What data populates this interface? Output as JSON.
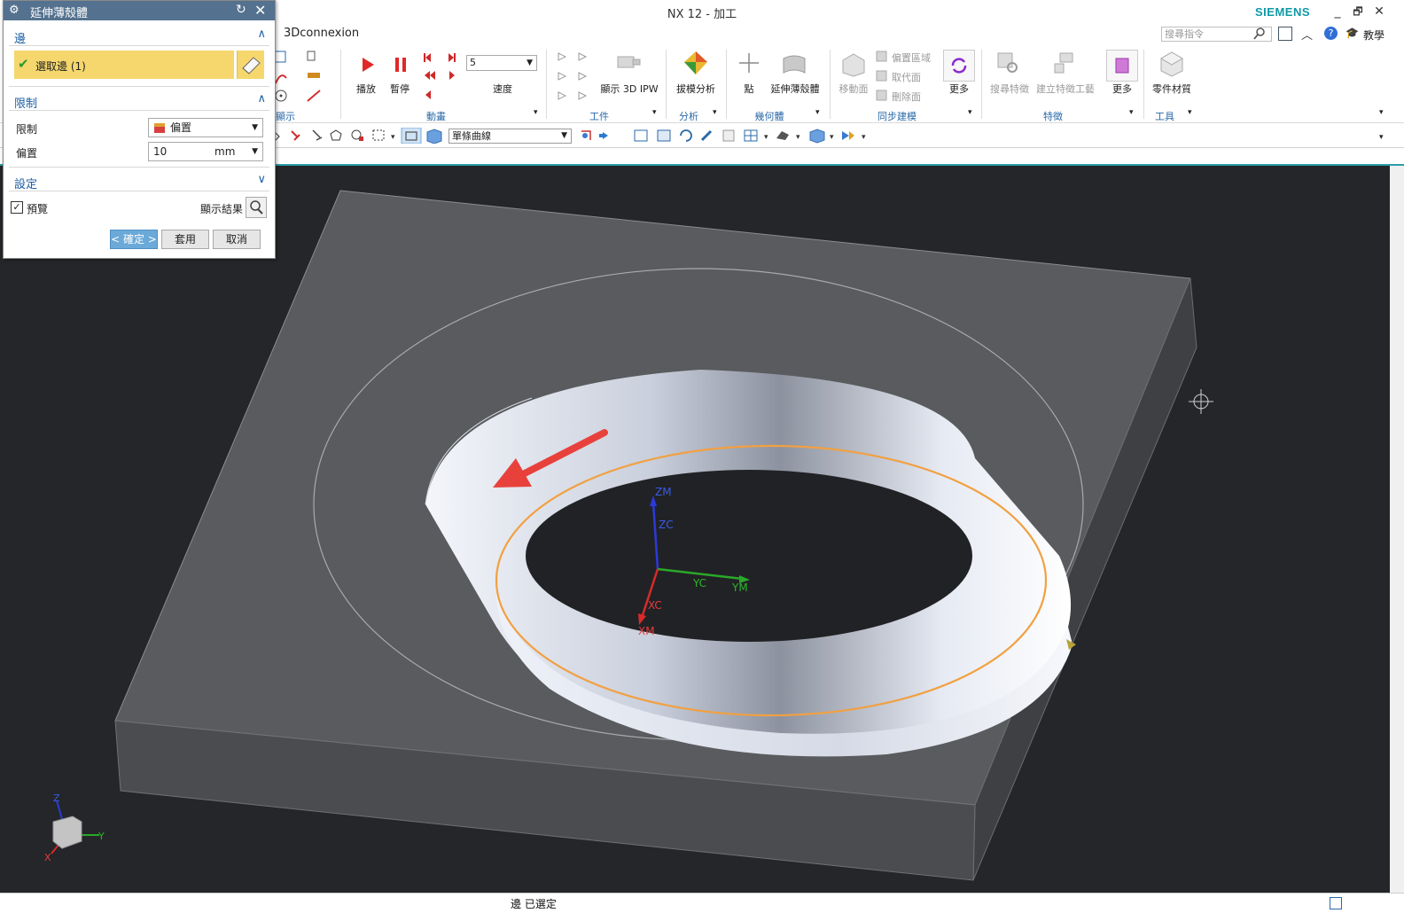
{
  "window": {
    "title": "NX 12 - 加工",
    "brand": "SIEMENS",
    "minimize": "_",
    "restore": "🗗",
    "close": "✕",
    "help_label": "教學"
  },
  "ribbon": {
    "visible_tab": "3Dconnexion",
    "search_placeholder": "搜尋指令",
    "partial_group_label": "顯示",
    "animation": {
      "play": "播放",
      "pause": "暫停",
      "speed_value": "5",
      "speed_label": "速度",
      "group": "動畫"
    },
    "work": {
      "ipw": "顯示 3D IPW",
      "group": "工件"
    },
    "analysis": {
      "draft": "拔模分析",
      "group": "分析"
    },
    "geometry": {
      "point": "點",
      "extend_shell": "延伸薄殼體",
      "group": "幾何體"
    },
    "sync": {
      "move_face": "移動面",
      "offset_region": "偏置區域",
      "replace_face": "取代面",
      "delete_face": "刪除面",
      "more": "更多",
      "group": "同步建模"
    },
    "feature": {
      "search_feature": "搜尋特徵",
      "create_tool": "建立特徵工藝",
      "more": "更多",
      "group": "特徵"
    },
    "tools": {
      "material": "零件材質",
      "group": "工具"
    }
  },
  "toolbar": {
    "curve_filter": "單條曲線"
  },
  "dialog": {
    "title": "延伸薄殼體",
    "edge_section": "邊",
    "select_edge": "選取邊 (1)",
    "limit_section": "限制",
    "limit_label": "限制",
    "limit_value": "偏置",
    "offset_label": "偏置",
    "offset_value": "10",
    "offset_unit": "mm",
    "settings_section": "設定",
    "preview_label": "預覽",
    "show_result": "顯示結果",
    "ok": "< 確定 >",
    "apply": "套用",
    "cancel": "取消"
  },
  "viewport": {
    "csys": {
      "zm": "ZM",
      "zc": "ZC",
      "yc": "YC",
      "ym": "YM",
      "xc": "XC",
      "xm": "XM"
    },
    "triad": {
      "z": "Z",
      "y": "Y",
      "x": "X"
    }
  },
  "status": {
    "message": "邊 已選定"
  },
  "colors": {
    "accent": "#2b9ea6",
    "dialog_title": "#54728f",
    "selection": "#f5d76e",
    "edge_highlight": "#f2a041",
    "arrow": "#e8413c"
  }
}
